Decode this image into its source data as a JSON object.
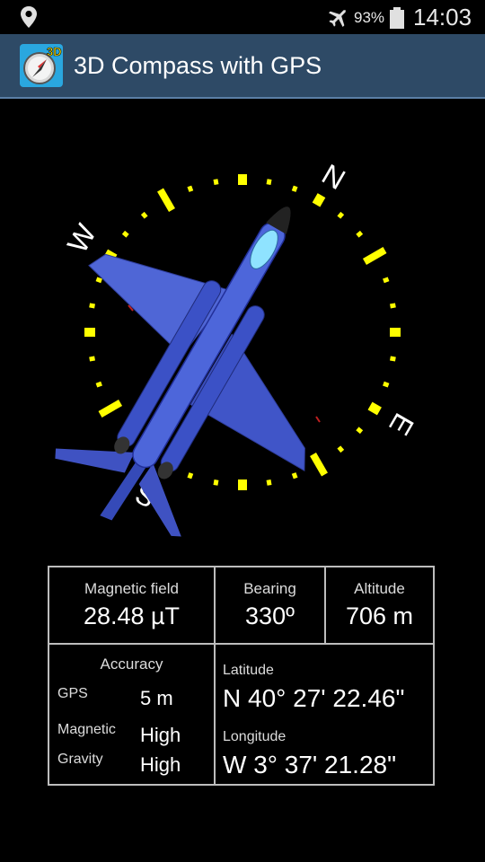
{
  "status_bar": {
    "battery": "93%",
    "time": "14:03"
  },
  "app": {
    "title": "3D Compass with GPS",
    "icon_badge": "3D"
  },
  "compass": {
    "cardinals": {
      "n": "N",
      "e": "E",
      "s": "S",
      "w": "W"
    }
  },
  "info": {
    "magnetic_field_label": "Magnetic field",
    "magnetic_field_value": "28.48 µT",
    "bearing_label": "Bearing",
    "bearing_value": "330º",
    "altitude_label": "Altitude",
    "altitude_value": "706 m",
    "accuracy": {
      "title": "Accuracy",
      "gps_label": "GPS",
      "gps_value": "5 m",
      "magnetic_label": "Magnetic",
      "magnetic_value": "High",
      "gravity_label": "Gravity",
      "gravity_value": "High"
    },
    "latitude_label": "Latitude",
    "latitude_value": "N 40° 27' 22.46\"",
    "longitude_label": "Longitude",
    "longitude_value": "W 3° 37' 21.28\""
  },
  "colors": {
    "action_bar": "#2e4a66",
    "tick": "#ffff00",
    "plane": "#4a5fd0"
  }
}
